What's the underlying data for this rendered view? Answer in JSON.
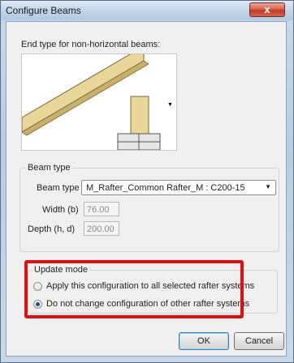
{
  "window": {
    "title": "Configure Beams",
    "close_glyph": "x"
  },
  "end_type": {
    "label": "End type for non-horizontal beams:"
  },
  "beam_type_group": {
    "title": "Beam type",
    "beam_type_label": "Beam type",
    "beam_type_value": "M_Rafter_Common Rafter_M : C200-15",
    "width_label": "Width (b)",
    "width_value": "76.00",
    "depth_label": "Depth (h, d)",
    "depth_value": "200.00"
  },
  "update_mode_group": {
    "title": "Update mode",
    "options": [
      {
        "label": "Apply this configuration to all selected rafter systems",
        "selected": false
      },
      {
        "label": "Do not change configuration of other rafter systems",
        "selected": true
      }
    ]
  },
  "buttons": {
    "ok": "OK",
    "cancel": "Cancel"
  },
  "colors": {
    "highlight": "#e01010",
    "radio_selected": "#1a4f8f",
    "close_button": "#c23a22"
  }
}
